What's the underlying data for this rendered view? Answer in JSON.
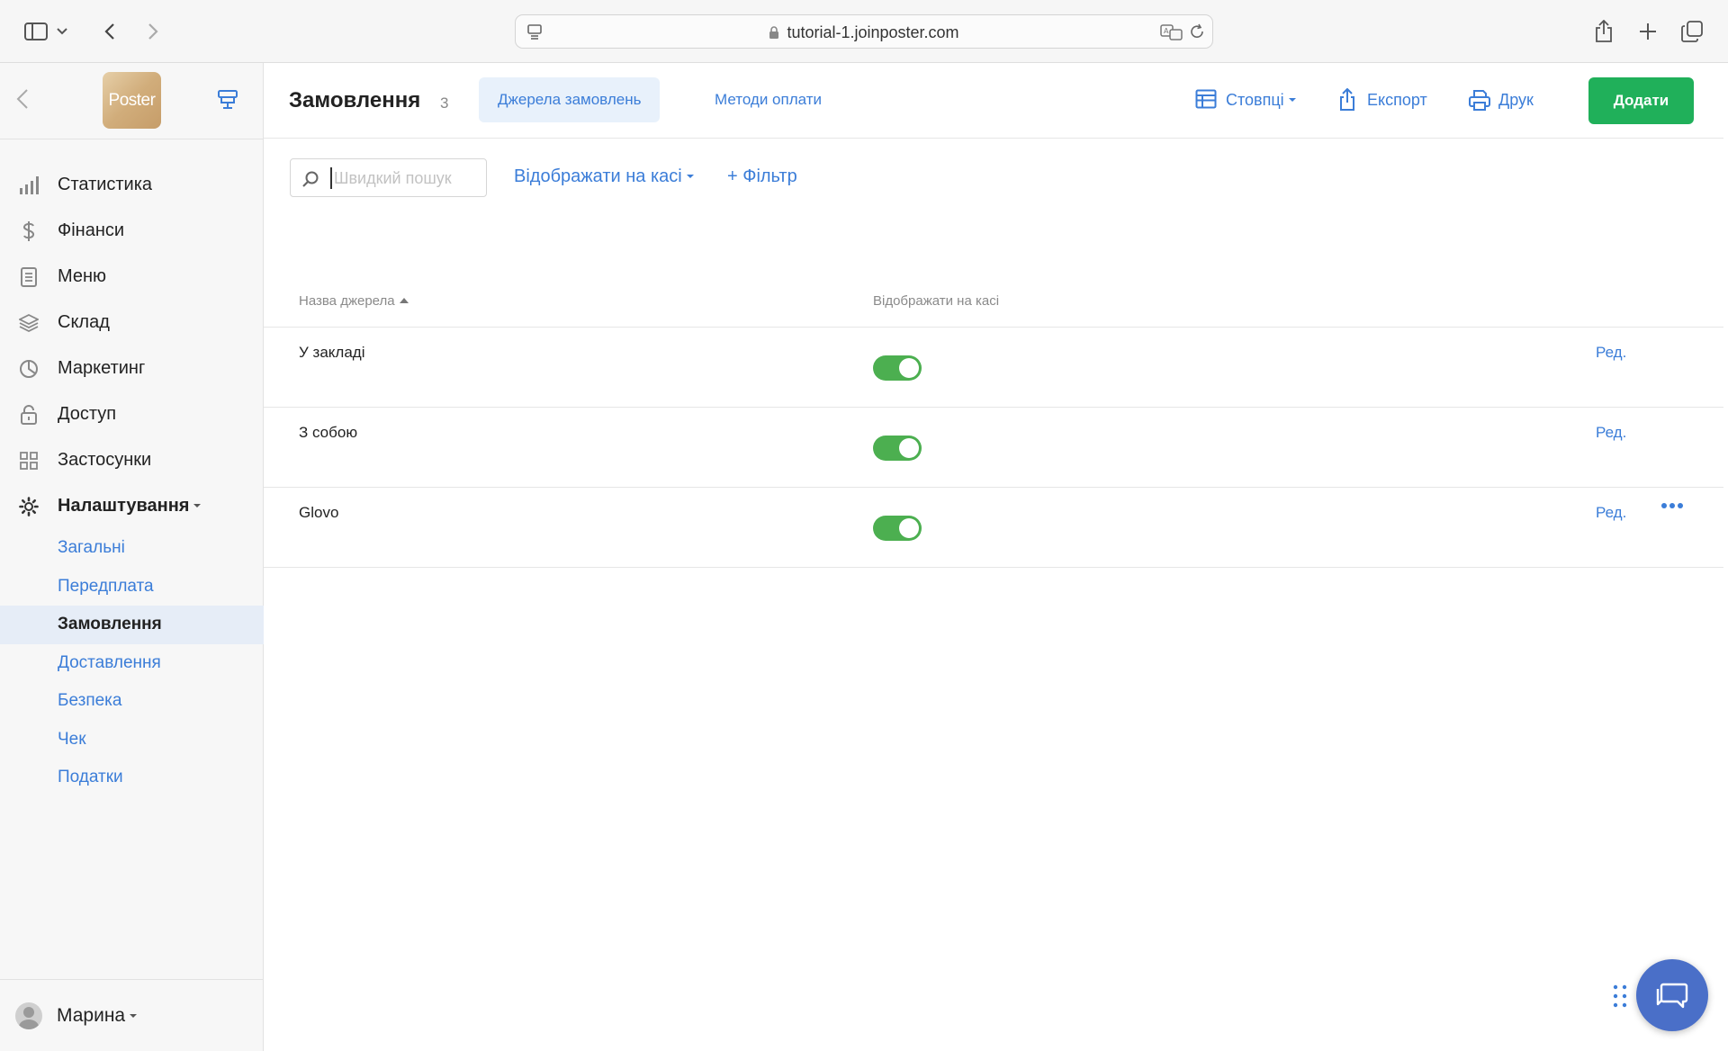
{
  "browser": {
    "url": "tutorial-1.joinposter.com"
  },
  "sidebar": {
    "logo_text": "Poster",
    "nav": [
      {
        "label": "Статистика",
        "icon": "bar-chart-icon"
      },
      {
        "label": "Фінанси",
        "icon": "dollar-icon"
      },
      {
        "label": "Меню",
        "icon": "document-icon"
      },
      {
        "label": "Склад",
        "icon": "layers-icon"
      },
      {
        "label": "Маркетинг",
        "icon": "pie-chart-icon"
      },
      {
        "label": "Доступ",
        "icon": "lock-icon"
      },
      {
        "label": "Застосунки",
        "icon": "grid-icon"
      },
      {
        "label": "Налаштування",
        "icon": "gear-icon"
      }
    ],
    "settings_sub": [
      {
        "label": "Загальні"
      },
      {
        "label": "Передплата"
      },
      {
        "label": "Замовлення",
        "active": true
      },
      {
        "label": "Доставлення"
      },
      {
        "label": "Безпека"
      },
      {
        "label": "Чек"
      },
      {
        "label": "Податки"
      }
    ],
    "user": "Марина"
  },
  "header": {
    "title": "Замовлення",
    "count": "3",
    "tabs": [
      {
        "label": "Джерела замовлень",
        "active": true
      },
      {
        "label": "Методи оплати",
        "active": false
      }
    ],
    "columns_label": "Стовпці",
    "export_label": "Експорт",
    "print_label": "Друк",
    "add_label": "Додати"
  },
  "filters": {
    "search_placeholder": "Швидкий пошук",
    "display_filter": "Відображати на касі",
    "add_filter": "+ Фільтр"
  },
  "table": {
    "columns": [
      "Назва джерела",
      "Відображати на касі"
    ],
    "rows": [
      {
        "name": "У закладі",
        "display": true,
        "edit": "Ред."
      },
      {
        "name": "З собою",
        "display": true,
        "edit": "Ред."
      },
      {
        "name": "Glovo",
        "display": true,
        "edit": "Ред.",
        "more": true
      }
    ]
  },
  "colors": {
    "accent": "#3b7dd8",
    "primary_button": "#20b05a",
    "toggle_on": "#4caf50",
    "chat_button": "#4a6fc8"
  }
}
